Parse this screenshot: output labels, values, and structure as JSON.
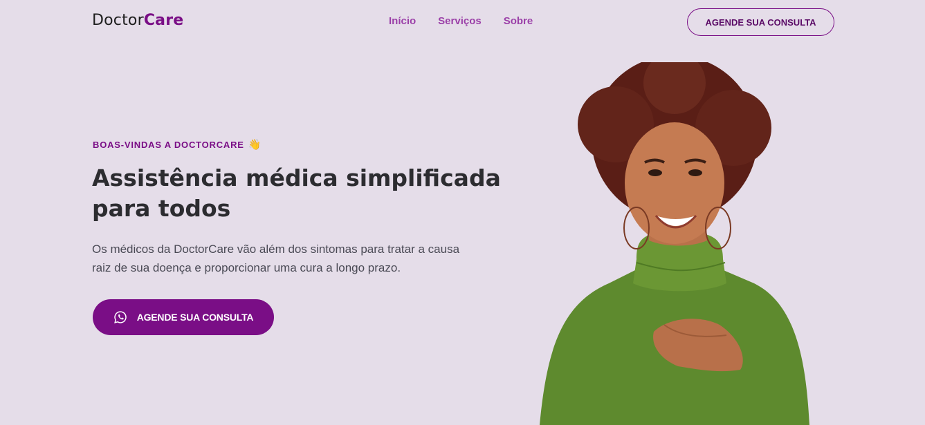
{
  "brand": {
    "name_part1": "Doctor",
    "name_part2": "Care",
    "accent": "#7A0E86"
  },
  "nav": {
    "items": [
      "Início",
      "Serviços",
      "Sobre"
    ]
  },
  "header_cta": "AGENDE SUA CONSULTA",
  "hero": {
    "eyebrow": "BOAS-VINDAS A DOCTORCARE",
    "eyebrow_icon": "waving-hand-icon",
    "title_line1": "Assistência médica simplificada",
    "title_line2": "para todos",
    "description_line1": "Os médicos da DoctorCare vão além dos sintomas para tratar a causa",
    "description_line2": "raiz de sua doença e proporcionar uma cura a longo prazo.",
    "cta": "AGENDE SUA CONSULTA",
    "cta_icon": "whatsapp-icon"
  },
  "colors": {
    "background": "#E5DDE9",
    "primary": "#7A0E86",
    "nav_link": "#9B3FA8"
  }
}
